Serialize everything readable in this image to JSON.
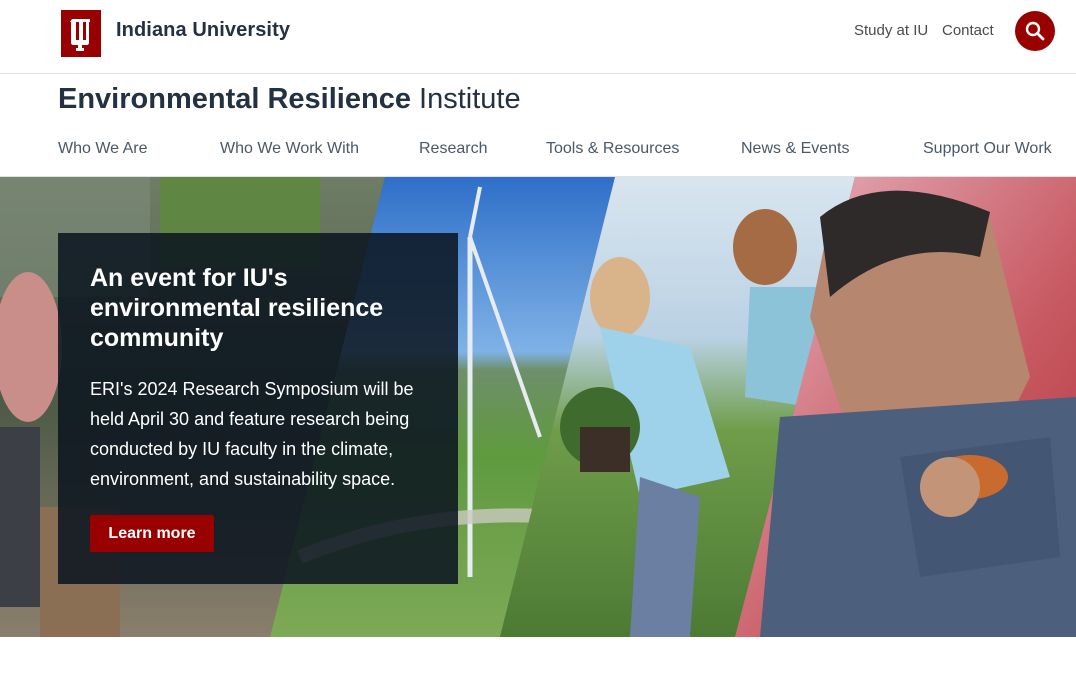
{
  "header": {
    "university_name": "Indiana University",
    "links": [
      {
        "label": "Study at IU"
      },
      {
        "label": "Contact"
      }
    ]
  },
  "site": {
    "title_strong": "Environmental Resilience",
    "title_light": "Institute"
  },
  "nav": {
    "items": [
      {
        "label": "Who We Are"
      },
      {
        "label": "Who We Work With"
      },
      {
        "label": "Research"
      },
      {
        "label": "Tools & Resources"
      },
      {
        "label": "News & Events"
      },
      {
        "label": "Support Our Work"
      }
    ]
  },
  "hero": {
    "heading": "An event for IU's environmental resilience community",
    "body": "ERI's 2024 Research Symposium will be held April 30 and feature research being conducted by IU faculty in the climate, environment, and sustainability space.",
    "button_label": "Learn more"
  },
  "colors": {
    "brand_crimson": "#990000",
    "text_dark": "#243142",
    "overlay": "#0a1420"
  },
  "icons": {
    "logo": "iu-trident-icon",
    "search": "search-icon"
  }
}
